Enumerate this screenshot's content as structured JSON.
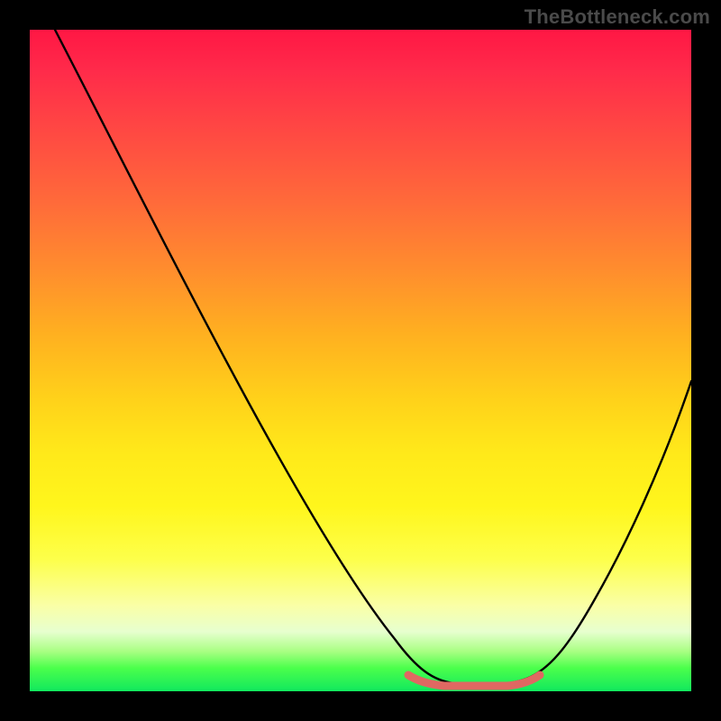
{
  "watermark": "TheBottleneck.com",
  "chart_data": {
    "type": "line",
    "title": "",
    "xlabel": "",
    "ylabel": "",
    "xlim": [
      0,
      100
    ],
    "ylim": [
      0,
      100
    ],
    "grid": false,
    "legend": false,
    "series": [
      {
        "name": "bottleneck-curve",
        "x": [
          5,
          10,
          15,
          20,
          25,
          30,
          35,
          40,
          45,
          50,
          55,
          58,
          60,
          63,
          66,
          70,
          72,
          76,
          80,
          85,
          90,
          95,
          100
        ],
        "y": [
          100,
          92,
          84,
          76,
          68,
          60,
          52,
          44,
          36,
          28,
          20,
          14,
          9,
          4,
          2,
          1,
          1,
          2,
          5,
          12,
          22,
          34,
          48
        ]
      },
      {
        "name": "flat-bottom-highlight",
        "x": [
          58,
          60,
          63,
          66,
          70,
          73,
          76
        ],
        "y": [
          3,
          1.5,
          1,
          1,
          1,
          1.5,
          3
        ]
      }
    ],
    "gradient_stops": [
      {
        "pos": 0,
        "color": "#ff1744"
      },
      {
        "pos": 14,
        "color": "#ff4444"
      },
      {
        "pos": 36,
        "color": "#ff8c2e"
      },
      {
        "pos": 56,
        "color": "#ffd21a"
      },
      {
        "pos": 80,
        "color": "#fdff4a"
      },
      {
        "pos": 91,
        "color": "#e7ffcf"
      },
      {
        "pos": 100,
        "color": "#11e85e"
      }
    ]
  }
}
